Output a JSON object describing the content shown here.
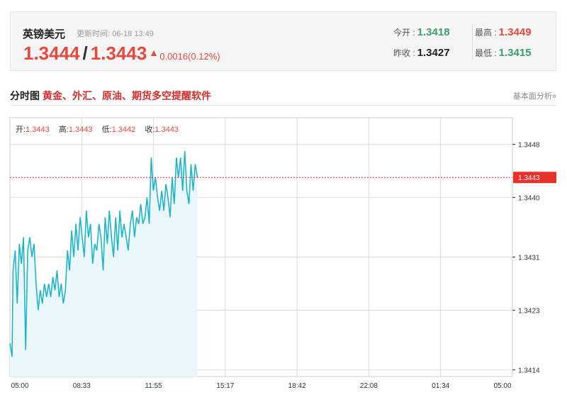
{
  "quote": {
    "name": "英镑美元",
    "update_label": "更新时间:",
    "update_time": "06-18 13:49",
    "bid": "1.3444",
    "ask": "1.3443",
    "change": "0.0016(0.12%)",
    "open_label": "今开 :",
    "open": "1.3418",
    "prev_close_label": "昨收 :",
    "prev_close": "1.3427",
    "high_label": "最高 :",
    "high": "1.3449",
    "low_label": "最低 :",
    "low": "1.3415"
  },
  "section": {
    "title": "分时图",
    "promo": "黄金、外汇、原油、期货多空提醒软件",
    "link": "基本面分析»"
  },
  "legend": {
    "open_label": "开:",
    "open": "1.3443",
    "high_label": "高:",
    "high": "1.3443",
    "low_label": "低:",
    "low": "1.3442",
    "close_label": "收:",
    "close": "1.3443"
  },
  "colors": {
    "up": "#e8483c",
    "down": "#3a9e6e",
    "line": "#1fb5c9",
    "area": "#eaf7fb",
    "grid": "#dedede",
    "current_price_bg": "#e8312a"
  },
  "chart_data": {
    "type": "line",
    "x_ticks": [
      "05:00",
      "08:33",
      "11:55",
      "15:17",
      "18:42",
      "22:08",
      "01:34",
      "05:00"
    ],
    "y_ticks": [
      1.3414,
      1.3423,
      1.3431,
      1.344,
      1.3448
    ],
    "ylim": [
      1.3413,
      1.3452
    ],
    "current_price": "1.3443",
    "grid": true,
    "x_session_hours": 24,
    "series": [
      {
        "x_hours": [
          0,
          0.1,
          0.15,
          0.25,
          0.35,
          0.45,
          0.55,
          0.65,
          0.75,
          0.85,
          0.95,
          1.05,
          1.15,
          1.25,
          1.35,
          1.45,
          1.55,
          1.65,
          1.75,
          1.85,
          1.95,
          2.05,
          2.15,
          2.25,
          2.35,
          2.45,
          2.55,
          2.65,
          2.75,
          2.85,
          2.95,
          3.05,
          3.15,
          3.25,
          3.35,
          3.45,
          3.55,
          3.65,
          3.75,
          3.85,
          3.95,
          4.05,
          4.15,
          4.25,
          4.35,
          4.45,
          4.55,
          4.65,
          4.75,
          4.85,
          4.95,
          5.05,
          5.15,
          5.25,
          5.35,
          5.45,
          5.55,
          5.65,
          5.75,
          5.85,
          5.95,
          6.05,
          6.15,
          6.25,
          6.35,
          6.45,
          6.55,
          6.65,
          6.75,
          6.85,
          6.95,
          7.05,
          7.15,
          7.25,
          7.35,
          7.45,
          7.55,
          7.65,
          7.75,
          7.85,
          7.95,
          8.05,
          8.15,
          8.25,
          8.35,
          8.45,
          8.55,
          8.65,
          8.75,
          8.85,
          8.95
        ],
        "values": [
          1.3418,
          1.3416,
          1.3429,
          1.3432,
          1.3424,
          1.3433,
          1.343,
          1.3434,
          1.3417,
          1.3432,
          1.3434,
          1.3431,
          1.3433,
          1.3427,
          1.3423,
          1.3426,
          1.3424,
          1.3427,
          1.3425,
          1.3427,
          1.3425,
          1.3428,
          1.3426,
          1.3429,
          1.3425,
          1.3427,
          1.3424,
          1.3426,
          1.3432,
          1.3429,
          1.3435,
          1.3431,
          1.3436,
          1.3432,
          1.3437,
          1.3434,
          1.3431,
          1.3438,
          1.3434,
          1.3436,
          1.343,
          1.3433,
          1.3432,
          1.3436,
          1.3434,
          1.3429,
          1.3437,
          1.3433,
          1.3438,
          1.3434,
          1.3431,
          1.3437,
          1.3432,
          1.3438,
          1.3434,
          1.3436,
          1.3434,
          1.3432,
          1.3436,
          1.3438,
          1.3434,
          1.3437,
          1.3436,
          1.3439,
          1.3436,
          1.3437,
          1.344,
          1.3436,
          1.3446,
          1.3441,
          1.3443,
          1.344,
          1.3438,
          1.3441,
          1.3438,
          1.3442,
          1.344,
          1.3437,
          1.3443,
          1.3439,
          1.3446,
          1.3443,
          1.3446,
          1.3441,
          1.3447,
          1.3441,
          1.3439,
          1.3445,
          1.3441,
          1.3445,
          1.3443
        ]
      }
    ]
  }
}
